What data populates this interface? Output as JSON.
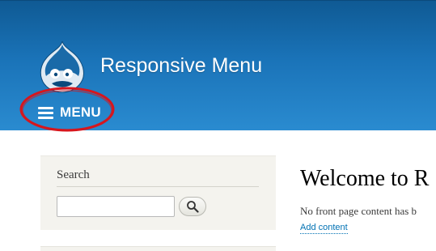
{
  "header": {
    "site_name": "Responsive Menu",
    "menu_label": "MENU",
    "gradient_top": "#0f5a94",
    "gradient_bottom": "#2a8bd0"
  },
  "annotation": {
    "ring_color": "#d7161d"
  },
  "sidebar": {
    "search_title": "Search",
    "search_value": "",
    "search_button_icon": "magnifier-icon",
    "background": "#f4f3ee"
  },
  "main": {
    "title": "Welcome to R",
    "text": "No front page content has b",
    "add_content_link": "Add content",
    "link_color": "#0071b3"
  }
}
